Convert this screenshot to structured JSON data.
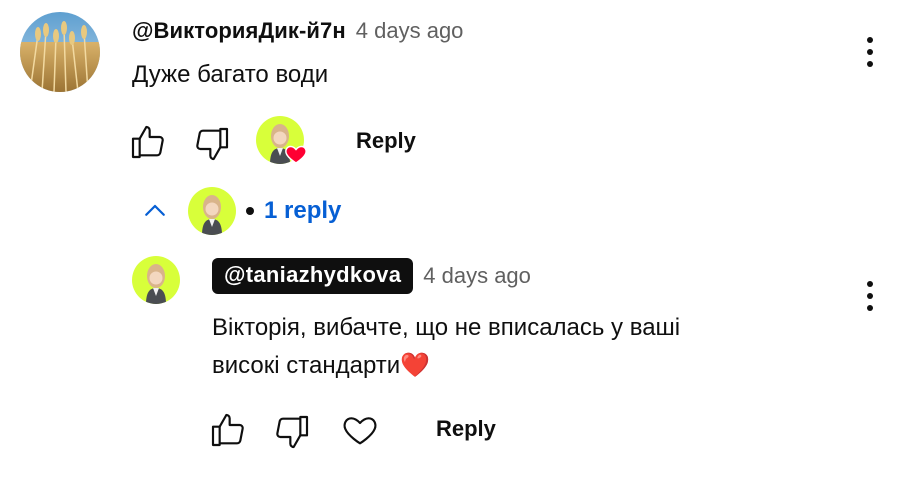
{
  "comment": {
    "author": "@ВикторияДик-й7н",
    "time": "4 days ago",
    "text": "Дуже багато води",
    "reply_label": "Reply",
    "icons": {
      "avatar": "wheat-field-avatar",
      "like": "thumbs-up-icon",
      "dislike": "thumbs-down-icon",
      "creator_heart": "creator-heart-icon",
      "menu": "more-vert-icon"
    },
    "colors": {
      "heart": "#ff0033"
    }
  },
  "replies_toggle": {
    "count_label": "1 reply",
    "colors": {
      "link": "#065fd4"
    }
  },
  "reply": {
    "author": "@taniazhydkova",
    "time": "4 days ago",
    "text_line1": "Вікторія, вибачте, що не вписалась у ваші",
    "text_line2": "високі стандарти❤️",
    "reply_label": "Reply",
    "colors": {
      "author_tag_bg": "#0f0f0f",
      "avatar_bg": "#d8ff3a"
    }
  }
}
